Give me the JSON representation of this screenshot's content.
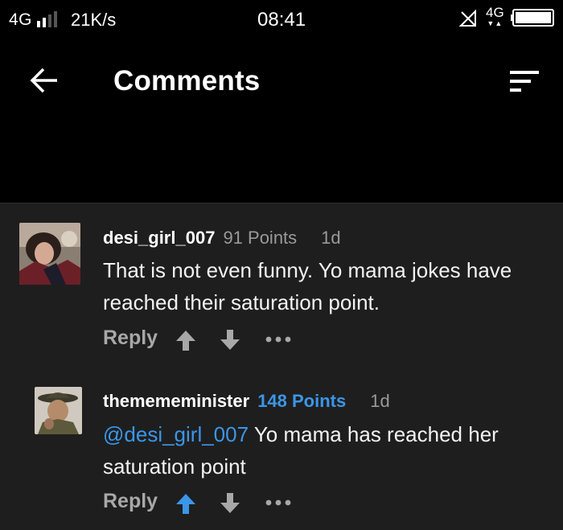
{
  "status_bar": {
    "network": "4G",
    "speed": "21K/s",
    "time": "08:41",
    "network2": "4G"
  },
  "app_bar": {
    "title": "Comments"
  },
  "comments": [
    {
      "username": "desi_girl_007",
      "points": "91 Points",
      "age": "1d",
      "text": "That is not even funny. Yo mama jokes have reached their saturation point.",
      "reply_label": "Reply",
      "upvoted": false
    },
    {
      "username": "themememinister",
      "points": "148 Points",
      "age": "1d",
      "mention": "@desi_girl_007",
      "text": " Yo mama has reached her saturation point",
      "reply_label": "Reply",
      "upvoted": true
    }
  ],
  "colors": {
    "background": "#000000",
    "list_background": "#1e1e1e",
    "accent_blue": "#3b96e8",
    "muted_text": "#9a9a9a"
  }
}
